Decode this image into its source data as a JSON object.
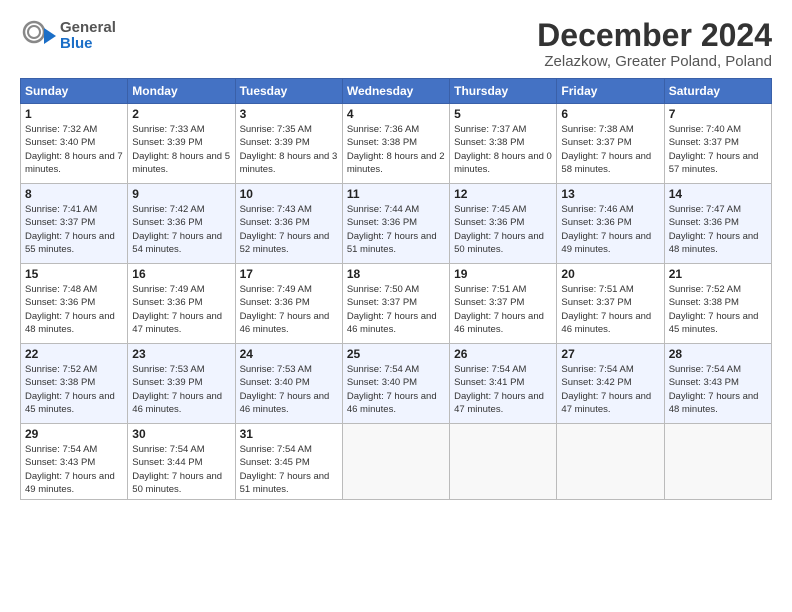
{
  "header": {
    "logo_line1": "General",
    "logo_line2": "Blue",
    "main_title": "December 2024",
    "subtitle": "Zelazkow, Greater Poland, Poland"
  },
  "weekdays": [
    "Sunday",
    "Monday",
    "Tuesday",
    "Wednesday",
    "Thursday",
    "Friday",
    "Saturday"
  ],
  "weeks": [
    [
      {
        "day": "1",
        "sunrise": "7:32 AM",
        "sunset": "3:40 PM",
        "daylight": "8 hours and 7 minutes."
      },
      {
        "day": "2",
        "sunrise": "7:33 AM",
        "sunset": "3:39 PM",
        "daylight": "8 hours and 5 minutes."
      },
      {
        "day": "3",
        "sunrise": "7:35 AM",
        "sunset": "3:39 PM",
        "daylight": "8 hours and 3 minutes."
      },
      {
        "day": "4",
        "sunrise": "7:36 AM",
        "sunset": "3:38 PM",
        "daylight": "8 hours and 2 minutes."
      },
      {
        "day": "5",
        "sunrise": "7:37 AM",
        "sunset": "3:38 PM",
        "daylight": "8 hours and 0 minutes."
      },
      {
        "day": "6",
        "sunrise": "7:38 AM",
        "sunset": "3:37 PM",
        "daylight": "7 hours and 58 minutes."
      },
      {
        "day": "7",
        "sunrise": "7:40 AM",
        "sunset": "3:37 PM",
        "daylight": "7 hours and 57 minutes."
      }
    ],
    [
      {
        "day": "8",
        "sunrise": "7:41 AM",
        "sunset": "3:37 PM",
        "daylight": "7 hours and 55 minutes."
      },
      {
        "day": "9",
        "sunrise": "7:42 AM",
        "sunset": "3:36 PM",
        "daylight": "7 hours and 54 minutes."
      },
      {
        "day": "10",
        "sunrise": "7:43 AM",
        "sunset": "3:36 PM",
        "daylight": "7 hours and 52 minutes."
      },
      {
        "day": "11",
        "sunrise": "7:44 AM",
        "sunset": "3:36 PM",
        "daylight": "7 hours and 51 minutes."
      },
      {
        "day": "12",
        "sunrise": "7:45 AM",
        "sunset": "3:36 PM",
        "daylight": "7 hours and 50 minutes."
      },
      {
        "day": "13",
        "sunrise": "7:46 AM",
        "sunset": "3:36 PM",
        "daylight": "7 hours and 49 minutes."
      },
      {
        "day": "14",
        "sunrise": "7:47 AM",
        "sunset": "3:36 PM",
        "daylight": "7 hours and 48 minutes."
      }
    ],
    [
      {
        "day": "15",
        "sunrise": "7:48 AM",
        "sunset": "3:36 PM",
        "daylight": "7 hours and 48 minutes."
      },
      {
        "day": "16",
        "sunrise": "7:49 AM",
        "sunset": "3:36 PM",
        "daylight": "7 hours and 47 minutes."
      },
      {
        "day": "17",
        "sunrise": "7:49 AM",
        "sunset": "3:36 PM",
        "daylight": "7 hours and 46 minutes."
      },
      {
        "day": "18",
        "sunrise": "7:50 AM",
        "sunset": "3:37 PM",
        "daylight": "7 hours and 46 minutes."
      },
      {
        "day": "19",
        "sunrise": "7:51 AM",
        "sunset": "3:37 PM",
        "daylight": "7 hours and 46 minutes."
      },
      {
        "day": "20",
        "sunrise": "7:51 AM",
        "sunset": "3:37 PM",
        "daylight": "7 hours and 46 minutes."
      },
      {
        "day": "21",
        "sunrise": "7:52 AM",
        "sunset": "3:38 PM",
        "daylight": "7 hours and 45 minutes."
      }
    ],
    [
      {
        "day": "22",
        "sunrise": "7:52 AM",
        "sunset": "3:38 PM",
        "daylight": "7 hours and 45 minutes."
      },
      {
        "day": "23",
        "sunrise": "7:53 AM",
        "sunset": "3:39 PM",
        "daylight": "7 hours and 46 minutes."
      },
      {
        "day": "24",
        "sunrise": "7:53 AM",
        "sunset": "3:40 PM",
        "daylight": "7 hours and 46 minutes."
      },
      {
        "day": "25",
        "sunrise": "7:54 AM",
        "sunset": "3:40 PM",
        "daylight": "7 hours and 46 minutes."
      },
      {
        "day": "26",
        "sunrise": "7:54 AM",
        "sunset": "3:41 PM",
        "daylight": "7 hours and 47 minutes."
      },
      {
        "day": "27",
        "sunrise": "7:54 AM",
        "sunset": "3:42 PM",
        "daylight": "7 hours and 47 minutes."
      },
      {
        "day": "28",
        "sunrise": "7:54 AM",
        "sunset": "3:43 PM",
        "daylight": "7 hours and 48 minutes."
      }
    ],
    [
      {
        "day": "29",
        "sunrise": "7:54 AM",
        "sunset": "3:43 PM",
        "daylight": "7 hours and 49 minutes."
      },
      {
        "day": "30",
        "sunrise": "7:54 AM",
        "sunset": "3:44 PM",
        "daylight": "7 hours and 50 minutes."
      },
      {
        "day": "31",
        "sunrise": "7:54 AM",
        "sunset": "3:45 PM",
        "daylight": "7 hours and 51 minutes."
      },
      null,
      null,
      null,
      null
    ]
  ]
}
